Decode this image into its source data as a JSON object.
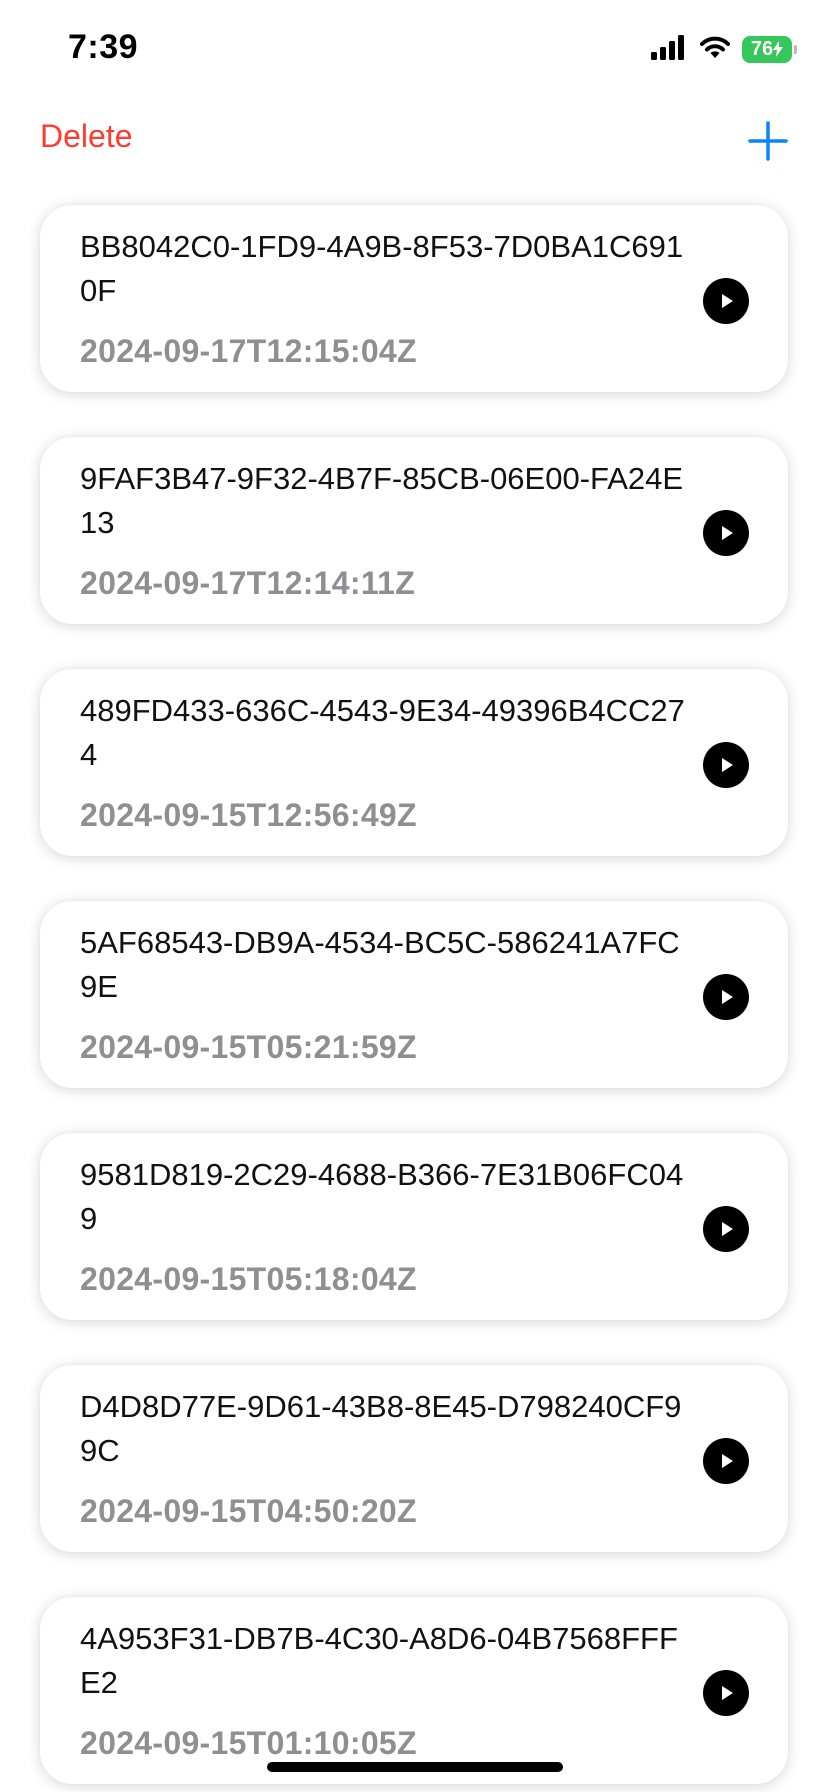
{
  "status_bar": {
    "time": "7:39",
    "battery_level": "76",
    "signal_icon": "cellular-signal-icon",
    "wifi_icon": "wifi-icon",
    "battery_color": "#35c759"
  },
  "nav": {
    "delete_label": "Delete",
    "delete_color": "#ff3b30",
    "add_icon": "plus-icon",
    "add_color": "#0a84ff"
  },
  "recordings": [
    {
      "id": "BB8042C0-1FD9-4A9B-8F53-7D0BA1C6910F",
      "date": "2024-09-17T12:15:04Z",
      "action_icon": "play-icon"
    },
    {
      "id": "9FAF3B47-9F32-4B7F-85CB-06E00-FA24E13",
      "date": "2024-09-17T12:14:11Z",
      "action_icon": "play-icon"
    },
    {
      "id": "489FD433-636C-4543-9E34-49396B4CC274",
      "date": "2024-09-15T12:56:49Z",
      "action_icon": "play-icon"
    },
    {
      "id": "5AF68543-DB9A-4534-BC5C-586241A7FC9E",
      "date": "2024-09-15T05:21:59Z",
      "action_icon": "play-icon"
    },
    {
      "id": "9581D819-2C29-4688-B366-7E31B06FC049",
      "date": "2024-09-15T05:18:04Z",
      "action_icon": "play-icon"
    },
    {
      "id": "D4D8D77E-9D61-43B8-8E45-D798240CF99C",
      "date": "2024-09-15T04:50:20Z",
      "action_icon": "play-icon"
    },
    {
      "id": "4A953F31-DB7B-4C30-A8D6-04B7568FFFE2",
      "date": "2024-09-15T01:10:05Z",
      "action_icon": "play-icon"
    }
  ]
}
